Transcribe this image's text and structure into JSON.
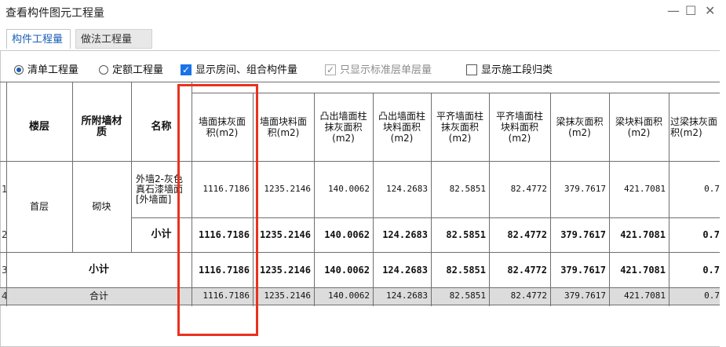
{
  "window": {
    "title": "查看构件图元工程量",
    "minimize_glyph": "—",
    "maximize_glyph": "☐",
    "close_glyph": "✕"
  },
  "tabs": [
    {
      "label": "构件工程量",
      "active": true
    },
    {
      "label": "做法工程量",
      "active": false
    }
  ],
  "options": {
    "radio_qing": {
      "label": "清单工程量",
      "selected": true
    },
    "radio_ding": {
      "label": "定额工程量",
      "selected": false
    },
    "cb_room": {
      "label": "显示房间、组合构件量",
      "checked": true
    },
    "cb_std": {
      "label": "只显示标准层单层量",
      "checked": true,
      "disabled": true
    },
    "cb_stage": {
      "label": "显示施工段归类",
      "checked": false
    }
  },
  "table": {
    "headers": {
      "floor": "楼层",
      "wall": "所附墙材质",
      "name": "名称",
      "cols": [
        "墙面抹灰面积(m2)",
        "墙面块料面积(m2)",
        "凸出墙面柱抹灰面积(m2)",
        "凸出墙面柱块料面积(m2)",
        "平齐墙面柱抹灰面积(m2)",
        "平齐墙面柱块料面积(m2)",
        "梁抹灰面积(m2)",
        "梁块料面积(m2)",
        "过梁抹灰面积(m2)"
      ]
    },
    "row_numbers": [
      "1",
      "2",
      "3",
      "4"
    ],
    "floor_value": "首层",
    "wall_value": "砌块",
    "name_value": "外墙2-灰色真石漆墙面[外墙面]",
    "subtotal_label": "小计",
    "total_label": "合计",
    "row1": [
      "1116.7186",
      "1235.2146",
      "140.0062",
      "124.2683",
      "82.5851",
      "82.4772",
      "379.7617",
      "421.7081",
      "0.7"
    ],
    "row2": [
      "1116.7186",
      "1235.2146",
      "140.0062",
      "124.2683",
      "82.5851",
      "82.4772",
      "379.7617",
      "421.7081",
      "0.7"
    ],
    "row3": [
      "1116.7186",
      "1235.2146",
      "140.0062",
      "124.2683",
      "82.5851",
      "82.4772",
      "379.7617",
      "421.7081",
      "0.7"
    ],
    "row4": [
      "1116.7186",
      "1235.2146",
      "140.0062",
      "124.2683",
      "82.5851",
      "82.4772",
      "379.7617",
      "421.7081",
      "0.7"
    ]
  },
  "colors": {
    "highlight_box": "#e8321e",
    "accent": "#1a73e8",
    "total_row_bg": "#dcdcdc"
  }
}
